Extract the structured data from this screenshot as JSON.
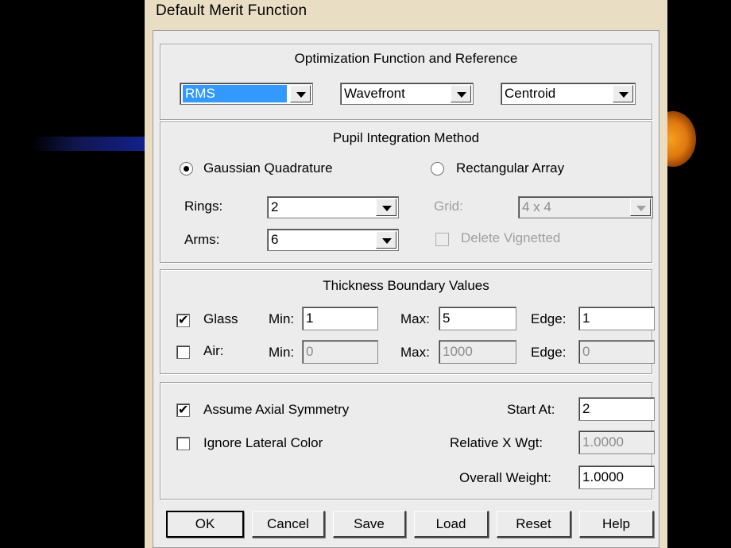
{
  "window": {
    "title": "Default Merit Function"
  },
  "optimization": {
    "title": "Optimization Function and Reference",
    "type": "RMS",
    "criterion": "Wavefront",
    "reference": "Centroid"
  },
  "pupil": {
    "title": "Pupil Integration Method",
    "gaussian_label": "Gaussian Quadrature",
    "rectangular_label": "Rectangular Array",
    "rings_label": "Rings:",
    "rings_value": "2",
    "arms_label": "Arms:",
    "arms_value": "6",
    "grid_label": "Grid:",
    "grid_value": "4 x 4",
    "delete_vignetted_label": "Delete Vignetted"
  },
  "thickness": {
    "title": "Thickness Boundary Values",
    "glass_label": "Glass",
    "air_label": "Air:",
    "min_label": "Min:",
    "max_label": "Max:",
    "edge_label": "Edge:",
    "glass_min": "1",
    "glass_max": "5",
    "glass_edge": "1",
    "air_min": "0",
    "air_max": "1000",
    "air_edge": "0"
  },
  "options": {
    "axial_label": "Assume Axial Symmetry",
    "lateral_label": "Ignore Lateral Color",
    "start_at_label": "Start At:",
    "start_at_value": "2",
    "rel_x_wgt_label": "Relative X Wgt:",
    "rel_x_wgt_value": "1.0000",
    "overall_weight_label": "Overall Weight:",
    "overall_weight_value": "1.0000"
  },
  "buttons": {
    "ok": "OK",
    "cancel": "Cancel",
    "save": "Save",
    "load": "Load",
    "reset": "Reset",
    "help": "Help"
  },
  "icons": {
    "check": "✔",
    "dropdown": "chevron-down-icon"
  }
}
